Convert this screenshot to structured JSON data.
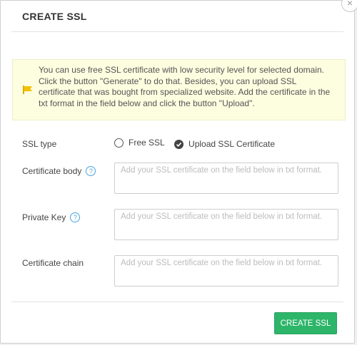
{
  "modal": {
    "title": "CREATE SSL",
    "close_symbol": "×"
  },
  "notice": {
    "icon": "flag-icon",
    "text": "You can use free SSL certificate with low security level for selected domain. Click the button \"Generate\" to do that. Besides, you can upload SSL certificate that was bought from specialized website. Add the certificate in the txt format in the field below and click the button \"Upload\"."
  },
  "form": {
    "ssl_type_label": "SSL type",
    "options": [
      {
        "label": "Free SSL",
        "selected": false
      },
      {
        "label": "Upload SSL Certificate",
        "selected": true
      }
    ],
    "certificate_body_label": "Certificate body",
    "private_key_label": "Private Key",
    "certificate_chain_label": "Certificate chain",
    "help_symbol": "?",
    "placeholder": "Add your SSL certificate on the field below in txt format."
  },
  "footer": {
    "submit_label": "CREATE SSL"
  },
  "colors": {
    "accent_green": "#2db56a",
    "help_blue": "#4aa3df",
    "notice_bg": "#fdfde0",
    "flag_yellow": "#f2c200"
  }
}
